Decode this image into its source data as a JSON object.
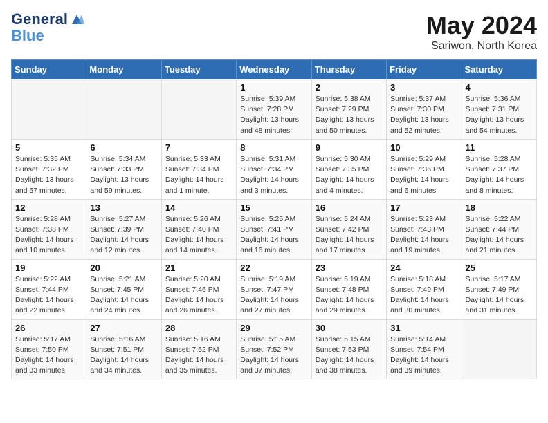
{
  "logo": {
    "line1": "General",
    "line2": "Blue"
  },
  "title": "May 2024",
  "subtitle": "Sariwon, North Korea",
  "days_header": [
    "Sunday",
    "Monday",
    "Tuesday",
    "Wednesday",
    "Thursday",
    "Friday",
    "Saturday"
  ],
  "weeks": [
    [
      {
        "day": "",
        "info": ""
      },
      {
        "day": "",
        "info": ""
      },
      {
        "day": "",
        "info": ""
      },
      {
        "day": "1",
        "info": "Sunrise: 5:39 AM\nSunset: 7:28 PM\nDaylight: 13 hours\nand 48 minutes."
      },
      {
        "day": "2",
        "info": "Sunrise: 5:38 AM\nSunset: 7:29 PM\nDaylight: 13 hours\nand 50 minutes."
      },
      {
        "day": "3",
        "info": "Sunrise: 5:37 AM\nSunset: 7:30 PM\nDaylight: 13 hours\nand 52 minutes."
      },
      {
        "day": "4",
        "info": "Sunrise: 5:36 AM\nSunset: 7:31 PM\nDaylight: 13 hours\nand 54 minutes."
      }
    ],
    [
      {
        "day": "5",
        "info": "Sunrise: 5:35 AM\nSunset: 7:32 PM\nDaylight: 13 hours\nand 57 minutes."
      },
      {
        "day": "6",
        "info": "Sunrise: 5:34 AM\nSunset: 7:33 PM\nDaylight: 13 hours\nand 59 minutes."
      },
      {
        "day": "7",
        "info": "Sunrise: 5:33 AM\nSunset: 7:34 PM\nDaylight: 14 hours\nand 1 minute."
      },
      {
        "day": "8",
        "info": "Sunrise: 5:31 AM\nSunset: 7:34 PM\nDaylight: 14 hours\nand 3 minutes."
      },
      {
        "day": "9",
        "info": "Sunrise: 5:30 AM\nSunset: 7:35 PM\nDaylight: 14 hours\nand 4 minutes."
      },
      {
        "day": "10",
        "info": "Sunrise: 5:29 AM\nSunset: 7:36 PM\nDaylight: 14 hours\nand 6 minutes."
      },
      {
        "day": "11",
        "info": "Sunrise: 5:28 AM\nSunset: 7:37 PM\nDaylight: 14 hours\nand 8 minutes."
      }
    ],
    [
      {
        "day": "12",
        "info": "Sunrise: 5:28 AM\nSunset: 7:38 PM\nDaylight: 14 hours\nand 10 minutes."
      },
      {
        "day": "13",
        "info": "Sunrise: 5:27 AM\nSunset: 7:39 PM\nDaylight: 14 hours\nand 12 minutes."
      },
      {
        "day": "14",
        "info": "Sunrise: 5:26 AM\nSunset: 7:40 PM\nDaylight: 14 hours\nand 14 minutes."
      },
      {
        "day": "15",
        "info": "Sunrise: 5:25 AM\nSunset: 7:41 PM\nDaylight: 14 hours\nand 16 minutes."
      },
      {
        "day": "16",
        "info": "Sunrise: 5:24 AM\nSunset: 7:42 PM\nDaylight: 14 hours\nand 17 minutes."
      },
      {
        "day": "17",
        "info": "Sunrise: 5:23 AM\nSunset: 7:43 PM\nDaylight: 14 hours\nand 19 minutes."
      },
      {
        "day": "18",
        "info": "Sunrise: 5:22 AM\nSunset: 7:44 PM\nDaylight: 14 hours\nand 21 minutes."
      }
    ],
    [
      {
        "day": "19",
        "info": "Sunrise: 5:22 AM\nSunset: 7:44 PM\nDaylight: 14 hours\nand 22 minutes."
      },
      {
        "day": "20",
        "info": "Sunrise: 5:21 AM\nSunset: 7:45 PM\nDaylight: 14 hours\nand 24 minutes."
      },
      {
        "day": "21",
        "info": "Sunrise: 5:20 AM\nSunset: 7:46 PM\nDaylight: 14 hours\nand 26 minutes."
      },
      {
        "day": "22",
        "info": "Sunrise: 5:19 AM\nSunset: 7:47 PM\nDaylight: 14 hours\nand 27 minutes."
      },
      {
        "day": "23",
        "info": "Sunrise: 5:19 AM\nSunset: 7:48 PM\nDaylight: 14 hours\nand 29 minutes."
      },
      {
        "day": "24",
        "info": "Sunrise: 5:18 AM\nSunset: 7:49 PM\nDaylight: 14 hours\nand 30 minutes."
      },
      {
        "day": "25",
        "info": "Sunrise: 5:17 AM\nSunset: 7:49 PM\nDaylight: 14 hours\nand 31 minutes."
      }
    ],
    [
      {
        "day": "26",
        "info": "Sunrise: 5:17 AM\nSunset: 7:50 PM\nDaylight: 14 hours\nand 33 minutes."
      },
      {
        "day": "27",
        "info": "Sunrise: 5:16 AM\nSunset: 7:51 PM\nDaylight: 14 hours\nand 34 minutes."
      },
      {
        "day": "28",
        "info": "Sunrise: 5:16 AM\nSunset: 7:52 PM\nDaylight: 14 hours\nand 35 minutes."
      },
      {
        "day": "29",
        "info": "Sunrise: 5:15 AM\nSunset: 7:52 PM\nDaylight: 14 hours\nand 37 minutes."
      },
      {
        "day": "30",
        "info": "Sunrise: 5:15 AM\nSunset: 7:53 PM\nDaylight: 14 hours\nand 38 minutes."
      },
      {
        "day": "31",
        "info": "Sunrise: 5:14 AM\nSunset: 7:54 PM\nDaylight: 14 hours\nand 39 minutes."
      },
      {
        "day": "",
        "info": ""
      }
    ]
  ]
}
